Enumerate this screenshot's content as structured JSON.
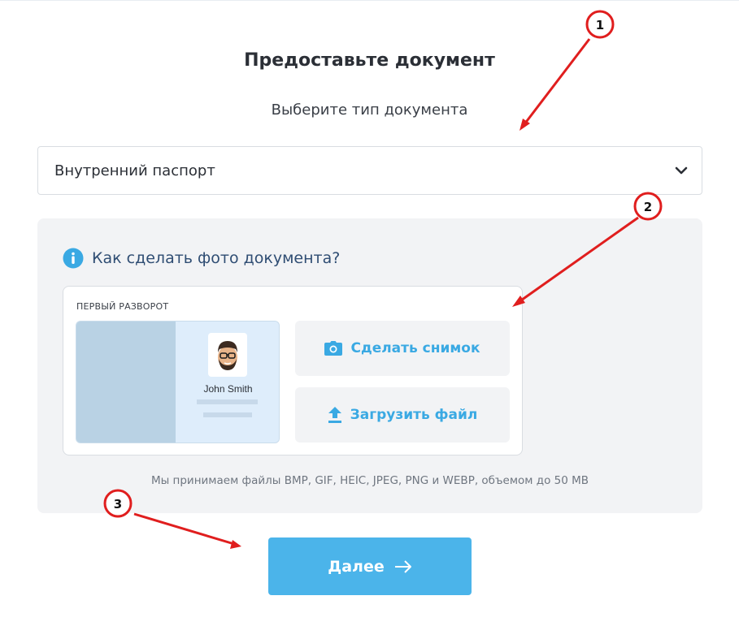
{
  "header": {
    "title": "Предоставьте документ",
    "subtitle": "Выберите тип документа"
  },
  "document_select": {
    "selected": "Внутренний паспорт",
    "icon": "chevron-down-icon"
  },
  "upload_panel": {
    "howto_label": "Как сделать фото документа?",
    "howto_icon": "info-icon",
    "card": {
      "title": "ПЕРВЫЙ РАЗВОРОТ",
      "sample_name": "John Smith",
      "take_photo_label": "Сделать снимок",
      "take_photo_icon": "camera-icon",
      "upload_label": "Загрузить файл",
      "upload_icon": "upload-icon"
    },
    "formats_note": "Мы принимаем файлы BMP, GIF, HEIC, JPEG, PNG и WEBP, объемом до 50 MB"
  },
  "footer": {
    "next_label": "Далее",
    "next_icon": "arrow-right-icon"
  },
  "annotations": {
    "markers": [
      "1",
      "2",
      "3"
    ],
    "color": "#e01e1e"
  },
  "colors": {
    "accent": "#4bb4ea",
    "link": "#3aa9e3",
    "panel_bg": "#f2f3f5"
  }
}
